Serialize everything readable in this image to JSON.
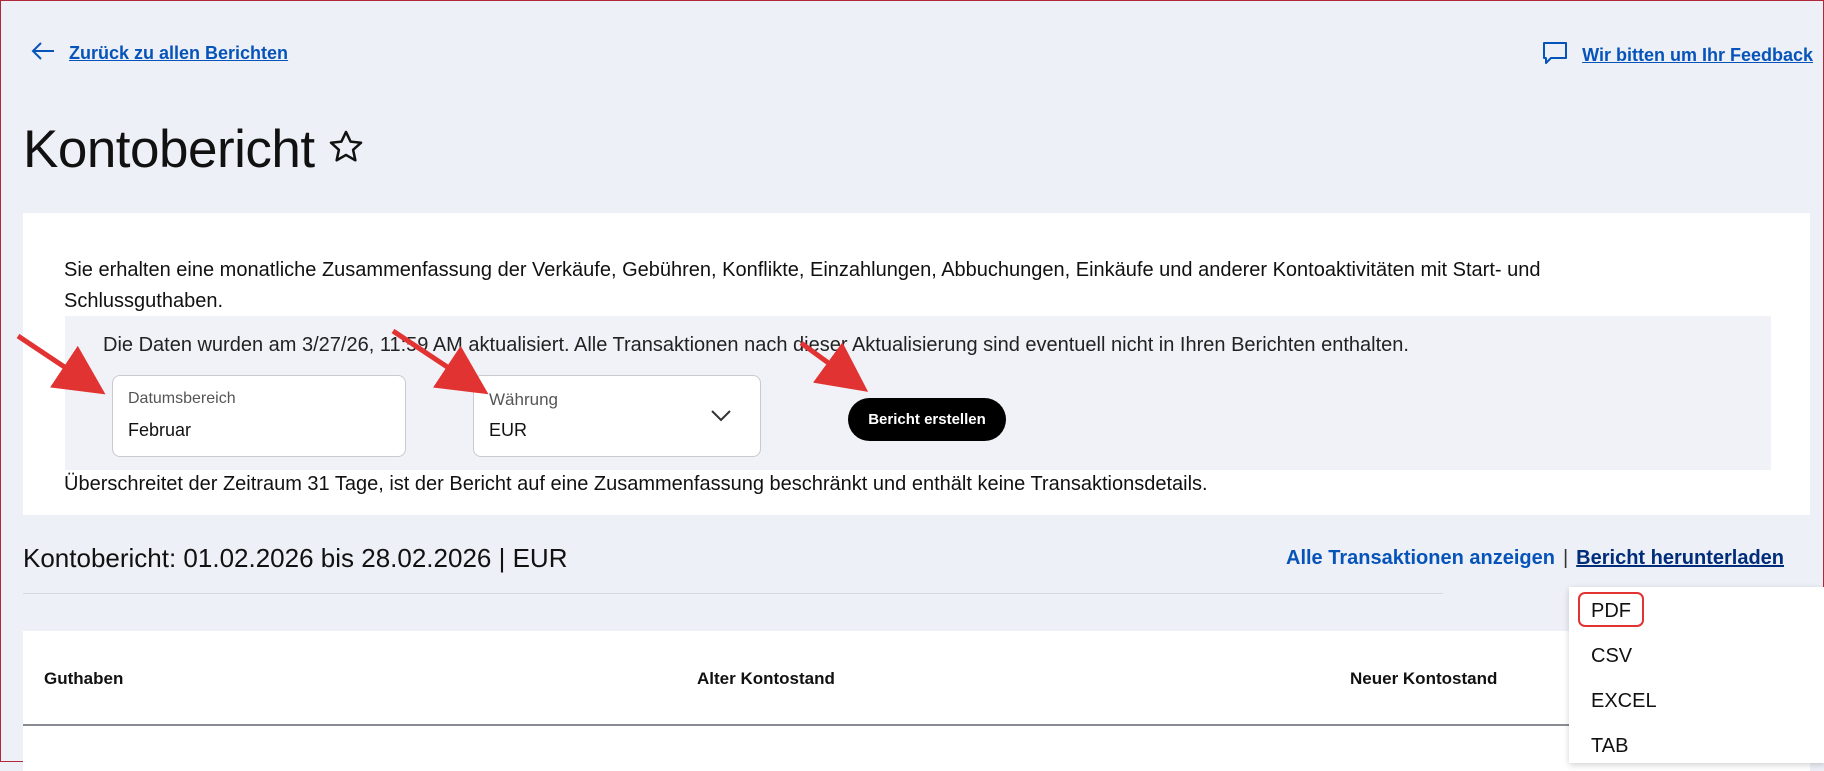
{
  "nav": {
    "back_label": "Zurück zu allen Berichten",
    "feedback_label": "Wir bitten um Ihr Feedback"
  },
  "page": {
    "title": "Kontobericht"
  },
  "card": {
    "description": "Sie erhalten eine monatliche Zusammenfassung der Verkäufe, Gebühren, Konflikte, Einzahlungen, Abbuchungen, Einkäufe und anderer Kontoaktivitäten mit Start- und Schlussguthaben.",
    "updated_text": "Die Daten wurden am 3/27/26, 11:59 AM aktualisiert. Alle Transaktionen nach dieser Aktualisierung sind eventuell nicht in Ihren Berichten enthalten.",
    "date_range": {
      "label": "Datumsbereich",
      "value": "Februar"
    },
    "currency": {
      "label": "Währung",
      "value": "EUR"
    },
    "create_button": "Bericht erstellen",
    "note": "Überschreitet der Zeitraum 31 Tage, ist der Bericht auf eine Zusammenfassung beschränkt und enthält keine Transaktionsdetails."
  },
  "report": {
    "title": "Kontobericht: 01.02.2026 bis 28.02.2026 | EUR",
    "show_all": "Alle Transaktionen anzeigen",
    "separator": "|",
    "download": "Bericht herunterladen"
  },
  "table": {
    "headers": [
      "Guthaben",
      "Alter Kontostand",
      "Neuer Kontostand"
    ]
  },
  "download_menu": {
    "items": [
      "PDF",
      "CSV",
      "EXCEL",
      "TAB"
    ]
  },
  "colors": {
    "link": "#0654ba",
    "annotation": "#e23333",
    "background": "#eef0f7"
  }
}
